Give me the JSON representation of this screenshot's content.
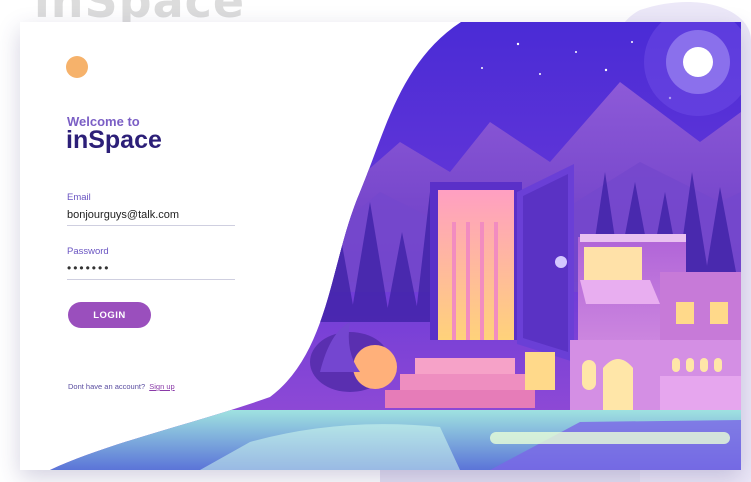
{
  "brand": {
    "background_text": "inSpace"
  },
  "login": {
    "welcome": "Welcome to",
    "title": "inSpace",
    "email_label": "Email",
    "email_value": "bonjourguys@talk.com",
    "password_label": "Password",
    "password_value": "•••••••",
    "login_button": "LOGIN",
    "signup_prompt": "Dont have an account?",
    "signup_link": "Sign up"
  },
  "colors": {
    "accent": "#9a4fbd",
    "title": "#2c1f78",
    "label": "#6a55c2",
    "logo": "#f6b26b"
  },
  "icons": {
    "logo": "orange-circle-logo-icon"
  }
}
